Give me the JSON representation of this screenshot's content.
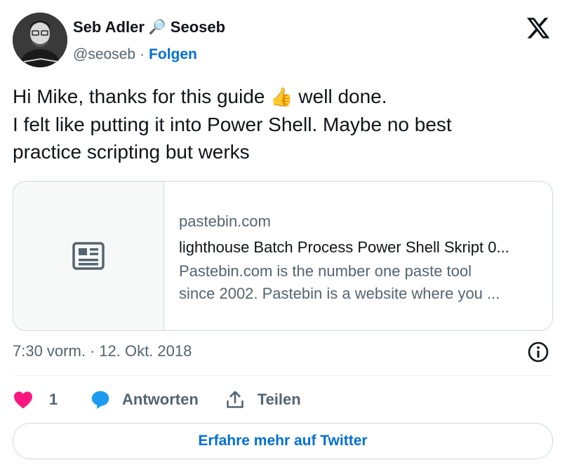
{
  "author": {
    "name": "Seb Adler",
    "emoji": "🔎",
    "display_suffix": "Seoseb",
    "handle": "@seoseb",
    "separator": "·",
    "follow_label": "Folgen"
  },
  "tweet": {
    "lines": [
      {
        "before": "Hi Mike, thanks for this guide ",
        "emoji": "👍",
        "after": " well done."
      },
      {
        "text": "I felt like putting it into Power Shell. Maybe no best"
      },
      {
        "text": "practice scripting but werks"
      }
    ]
  },
  "card": {
    "domain": "pastebin.com",
    "title": "lighthouse Batch Process Power Shell Skript 0...",
    "description_lines": [
      "Pastebin.com is the number one paste tool",
      "since 2002. Pastebin is a website where you ..."
    ],
    "thumbnail_icon": "article-icon"
  },
  "meta": {
    "time": "7:30 vorm.",
    "separator": "·",
    "date": "12. Okt. 2018"
  },
  "actions": {
    "like_count": "1",
    "reply_label": "Antworten",
    "share_label": "Teilen"
  },
  "cta_label": "Erfahre mehr auf Twitter",
  "colors": {
    "link": "#006fd6",
    "like": "#f91880",
    "reply": "#1d9bf0",
    "muted": "#536471",
    "border": "#cfd9de"
  }
}
